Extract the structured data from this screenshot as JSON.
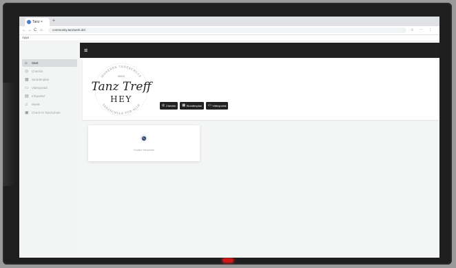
{
  "browser": {
    "tab_title": "Tanz ×",
    "new_tab": "+",
    "nav": {
      "back": "←",
      "forward": "→",
      "reload": "C",
      "home": "⌂"
    },
    "url": "community.tanzwerk.de/",
    "toolbar_icons": "☆ ⋯ ⋮",
    "bookmark": "Apps"
  },
  "sidebar": {
    "items": [
      {
        "icon": "home-icon",
        "glyph": "⌂",
        "label": "Start",
        "active": true
      },
      {
        "icon": "checkin-icon",
        "glyph": "◎",
        "label": "Checkin",
        "active": false
      },
      {
        "icon": "calendar-icon",
        "glyph": "▦",
        "label": "Stundenplan",
        "active": false
      },
      {
        "icon": "video-icon",
        "glyph": "▭",
        "label": "Videoportal",
        "active": false
      },
      {
        "icon": "document-icon",
        "glyph": "▤",
        "label": "Infoportal",
        "active": false
      },
      {
        "icon": "music-icon",
        "glyph": "♫",
        "label": "Musik",
        "active": false
      },
      {
        "icon": "school-icon",
        "glyph": "▣",
        "label": "Check-In Tanzschule",
        "active": false
      }
    ]
  },
  "topbar": {
    "menu_glyph": "≡"
  },
  "hero": {
    "logo_script": "Tanz Treff",
    "logo_word": "HEY",
    "logo_since": "SINCE",
    "logo_arc_top": "MODERNE TANZSCHULE",
    "logo_arc_bottom": "TANZSCHULE FÜR ALLE",
    "buttons": [
      {
        "icon": "checkin-icon",
        "glyph": "◎",
        "label": "Checkin"
      },
      {
        "icon": "calendar-icon",
        "glyph": "▦",
        "label": "Stundenplan"
      },
      {
        "icon": "video-icon",
        "glyph": "▭",
        "label": "Videoportal"
      }
    ]
  },
  "card": {
    "label": "Cookie Hinweise"
  },
  "colors": {
    "topbar": "#202020",
    "button": "#222222",
    "accent": "#d01818"
  }
}
